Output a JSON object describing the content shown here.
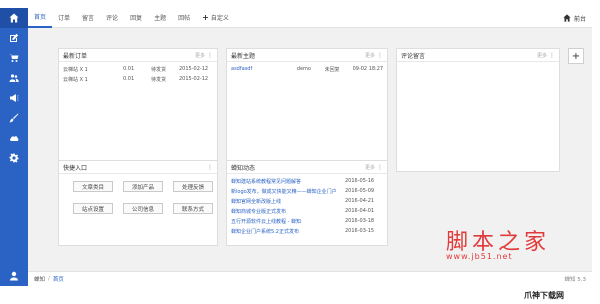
{
  "sidebar": {
    "icons": [
      "home-icon",
      "edit-icon",
      "cart-icon",
      "users-icon",
      "megaphone-icon",
      "brush-icon",
      "cloud-icon",
      "gear-icon",
      "user-icon"
    ]
  },
  "nav": {
    "tabs": [
      "首页",
      "订单",
      "留言",
      "评论",
      "回复",
      "主题",
      "回帖"
    ],
    "custom_label": "自定义",
    "front_label": "前台"
  },
  "panels": {
    "orders": {
      "title": "最新订单",
      "more": "更多",
      "rows": [
        {
          "name": "云梯站 X 1",
          "price": "0.01",
          "status": "待发货",
          "date": "2015-02-12"
        },
        {
          "name": "云梯站 X 1",
          "price": "0.01",
          "status": "待发货",
          "date": "2015-02-12"
        }
      ]
    },
    "topics": {
      "title": "最新主题",
      "more": "更多",
      "rows": [
        {
          "title": "asdfasdf",
          "user": "demo",
          "status": "未回复",
          "time": "09-02 18:27"
        }
      ]
    },
    "comments": {
      "title": "评论留言",
      "more": "更多"
    },
    "quick": {
      "title": "快捷入口",
      "buttons": [
        "文章类目",
        "添加产品",
        "处理反馈",
        "站点设置",
        "公司信息",
        "联系方式"
      ]
    },
    "news": {
      "title": "蝉知动态",
      "more": "更多",
      "items": [
        {
          "title": "蝉知建站系统教程常见问题解答",
          "date": "2016-05-16"
        },
        {
          "title": "新logo发布，做成又快能又精——蝉知企业门户",
          "date": "2016-05-09"
        },
        {
          "title": "蝉知官网全新改版上线",
          "date": "2016-04-21"
        },
        {
          "title": "蝉知商城专业版正式发布",
          "date": "2016-04-01"
        },
        {
          "title": "五行开源软件云上线教程 - 蝉知",
          "date": "2016-03-18"
        },
        {
          "title": "蝉知企业门户系统5.2正式发布",
          "date": "2016-03-15"
        }
      ]
    }
  },
  "footer": {
    "root": "蝉知",
    "crumb": "首页",
    "version": "蝉知 5.3"
  },
  "watermark": {
    "cn": "脚本之家",
    "url": "www.jb51.net",
    "logo": "爪神下载网"
  }
}
